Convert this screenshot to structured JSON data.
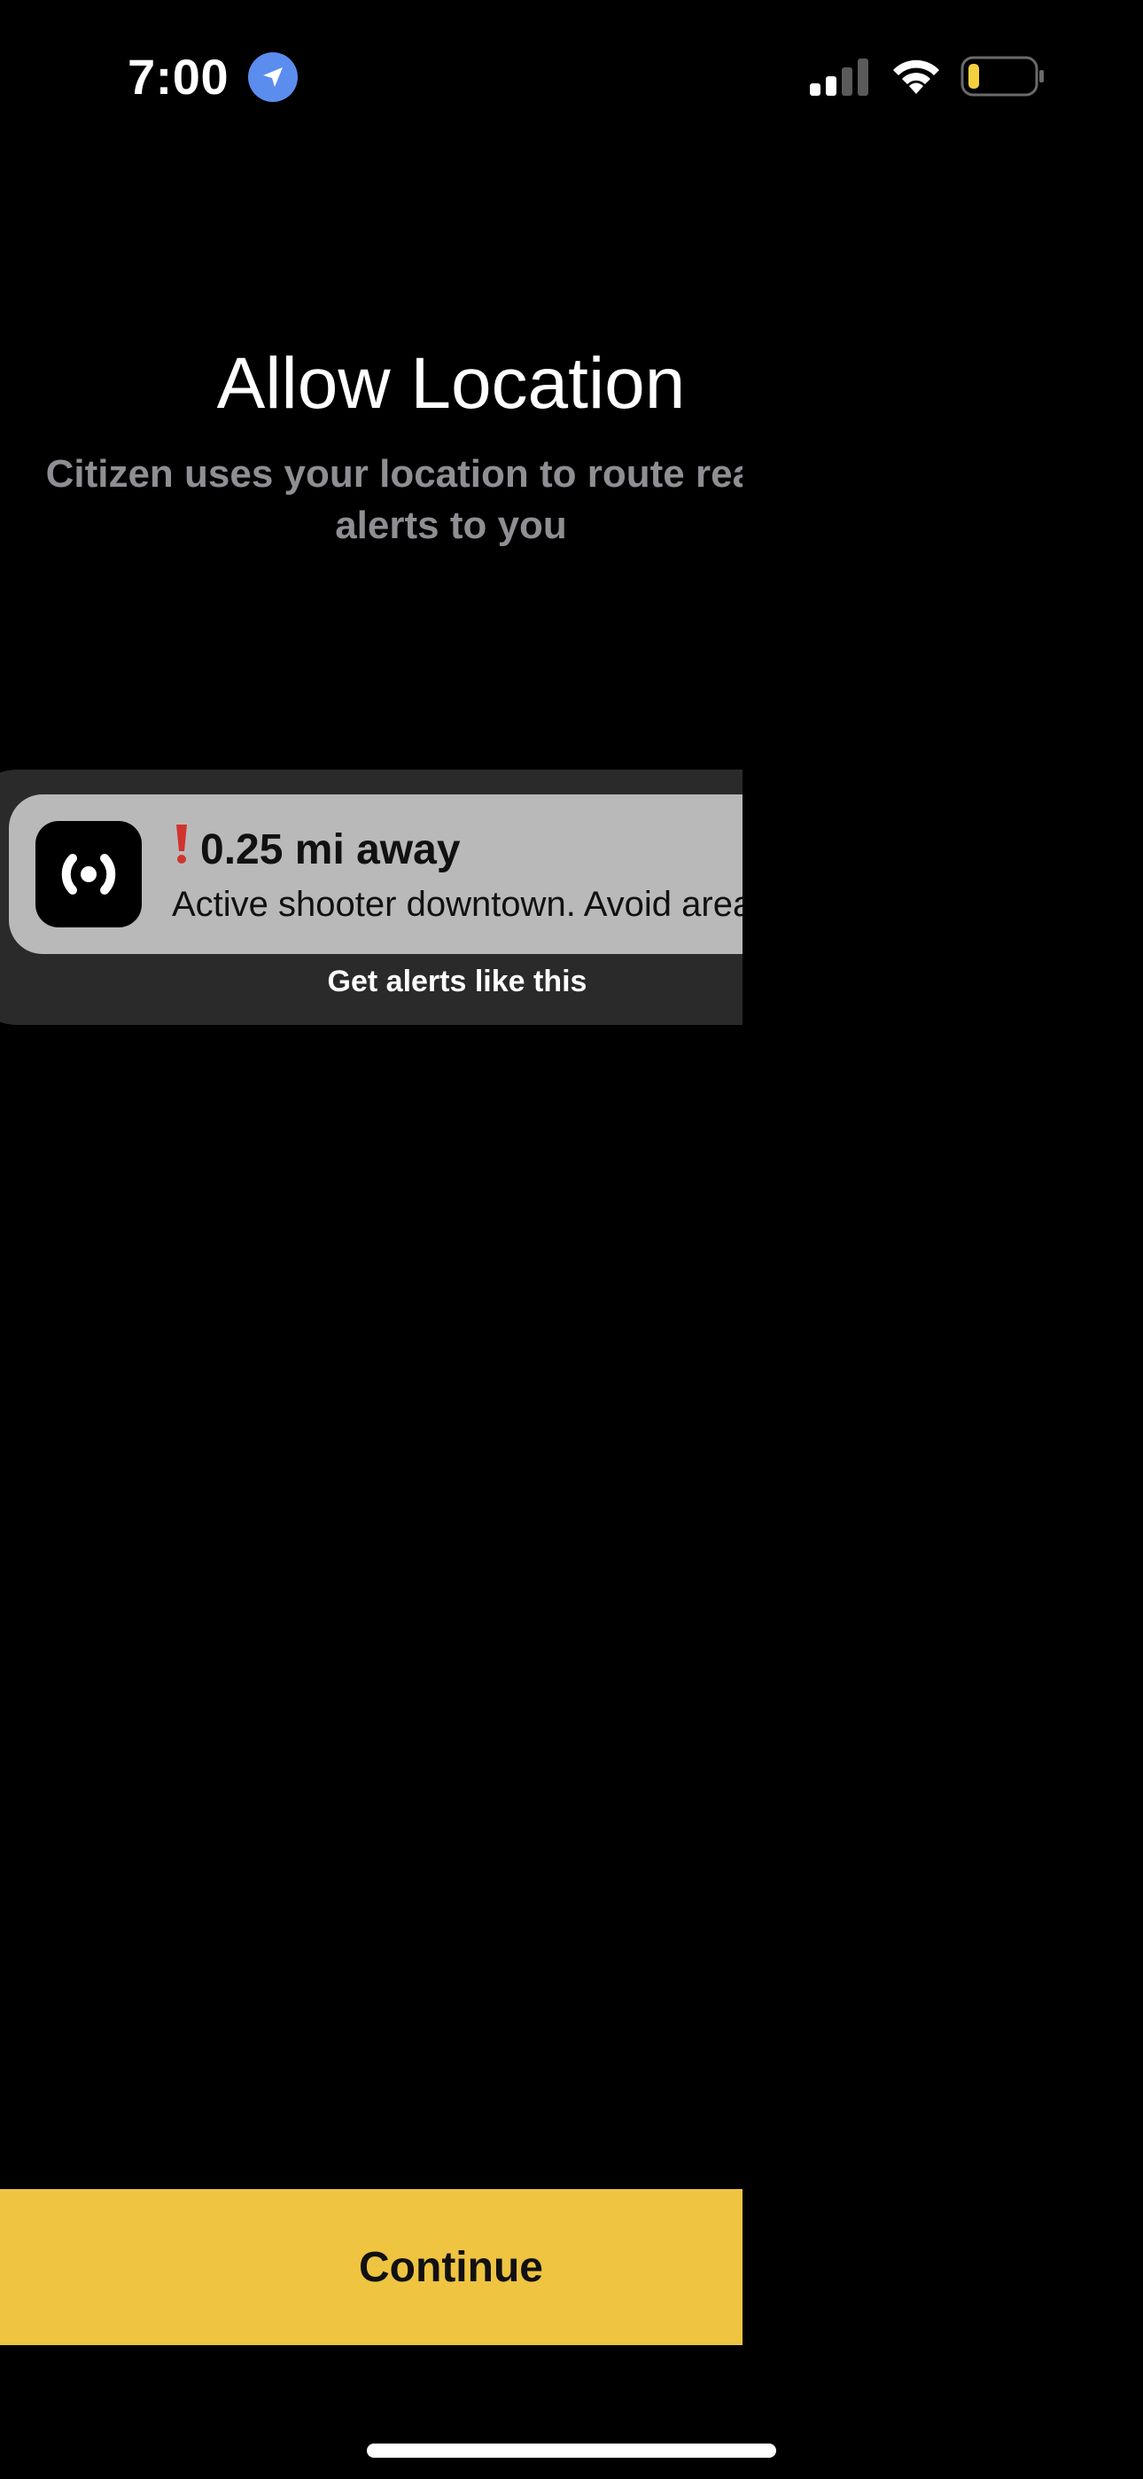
{
  "status_bar": {
    "time": "7:00",
    "location_icon": "location-arrow-icon",
    "signal_icon": "cellular-signal-icon",
    "wifi_icon": "wifi-icon",
    "battery_icon": "battery-low-icon",
    "battery_level": 0.15,
    "colors": {
      "location_badge": "#5b8def",
      "battery_fill": "#f4d03f"
    }
  },
  "onboarding": {
    "title": "Allow Location",
    "subtitle_line1": "Citizen uses your location to route real-time",
    "subtitle_line2": "alerts to you"
  },
  "alert_preview": {
    "app_icon": "citizen-broadcast-icon",
    "exclaim_icon": "exclamation-icon",
    "distance": "0.25 mi away",
    "body": "Active shooter downtown. Avoid area.",
    "caption": "Get alerts like this",
    "colors": {
      "exclaim": "#d0342c",
      "card_outer": "#2a2a2a",
      "card_inner": "#b9b9b9"
    }
  },
  "actions": {
    "continue_label": "Continue",
    "continue_color": "#eec441"
  }
}
